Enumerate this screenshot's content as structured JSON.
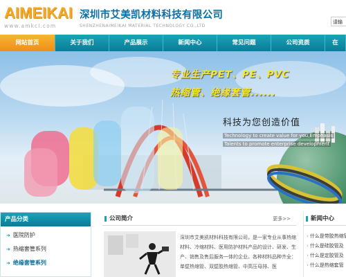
{
  "header": {
    "logo_text": "AIMEIKAI",
    "logo_url": "www.amkcl.com",
    "company_cn": "深圳市艾美凯材料科技有限公司",
    "company_en": "SHENZHENAIMEIKAI MATERIAL TECHNOLOGY CO.,LTD",
    "search_label": "请输"
  },
  "nav": {
    "items": [
      {
        "label": "网站首页",
        "active": true
      },
      {
        "label": "关于我们"
      },
      {
        "label": "产品展示"
      },
      {
        "label": "新闻中心"
      },
      {
        "label": "常见问题"
      },
      {
        "label": "公司资质"
      },
      {
        "label": "在"
      }
    ]
  },
  "banner": {
    "headline1": "专业生产PET、PE、PVC",
    "headline2": "热缩管、绝缘套管......",
    "slogan": "科技为您创造价值",
    "en_line1": "Technology to create value for you,Emphasis",
    "en_line2": "Talents to promote enterprise development"
  },
  "product_categories": {
    "title": "产品分类",
    "items": [
      "医院防护",
      "热缩套管系列",
      "绝缘套管系列"
    ]
  },
  "about": {
    "title": "公司简介",
    "more": "更多>>",
    "text": "深圳市艾美凯材料科技有限公司，是一家专业从事热缩材料、冷缩材料、医用防护材料产品的设计、研发、生产、销售及售后服务一体的企业。各种材料品种齐全：单壁热缩管、双壁胶热缩管、中高压母排、医"
  },
  "news": {
    "title": "新闻中心",
    "items": [
      "什么是带胶热缩管",
      "什么是硅胶管及",
      "什么是定胶管及",
      "什么是热缩套管"
    ]
  },
  "colors": {
    "nav_teal": "#0b7c98",
    "nav_active": "#ee8f18",
    "logo_orange": "#f0a92a",
    "company_blue": "#0d6fa2"
  }
}
